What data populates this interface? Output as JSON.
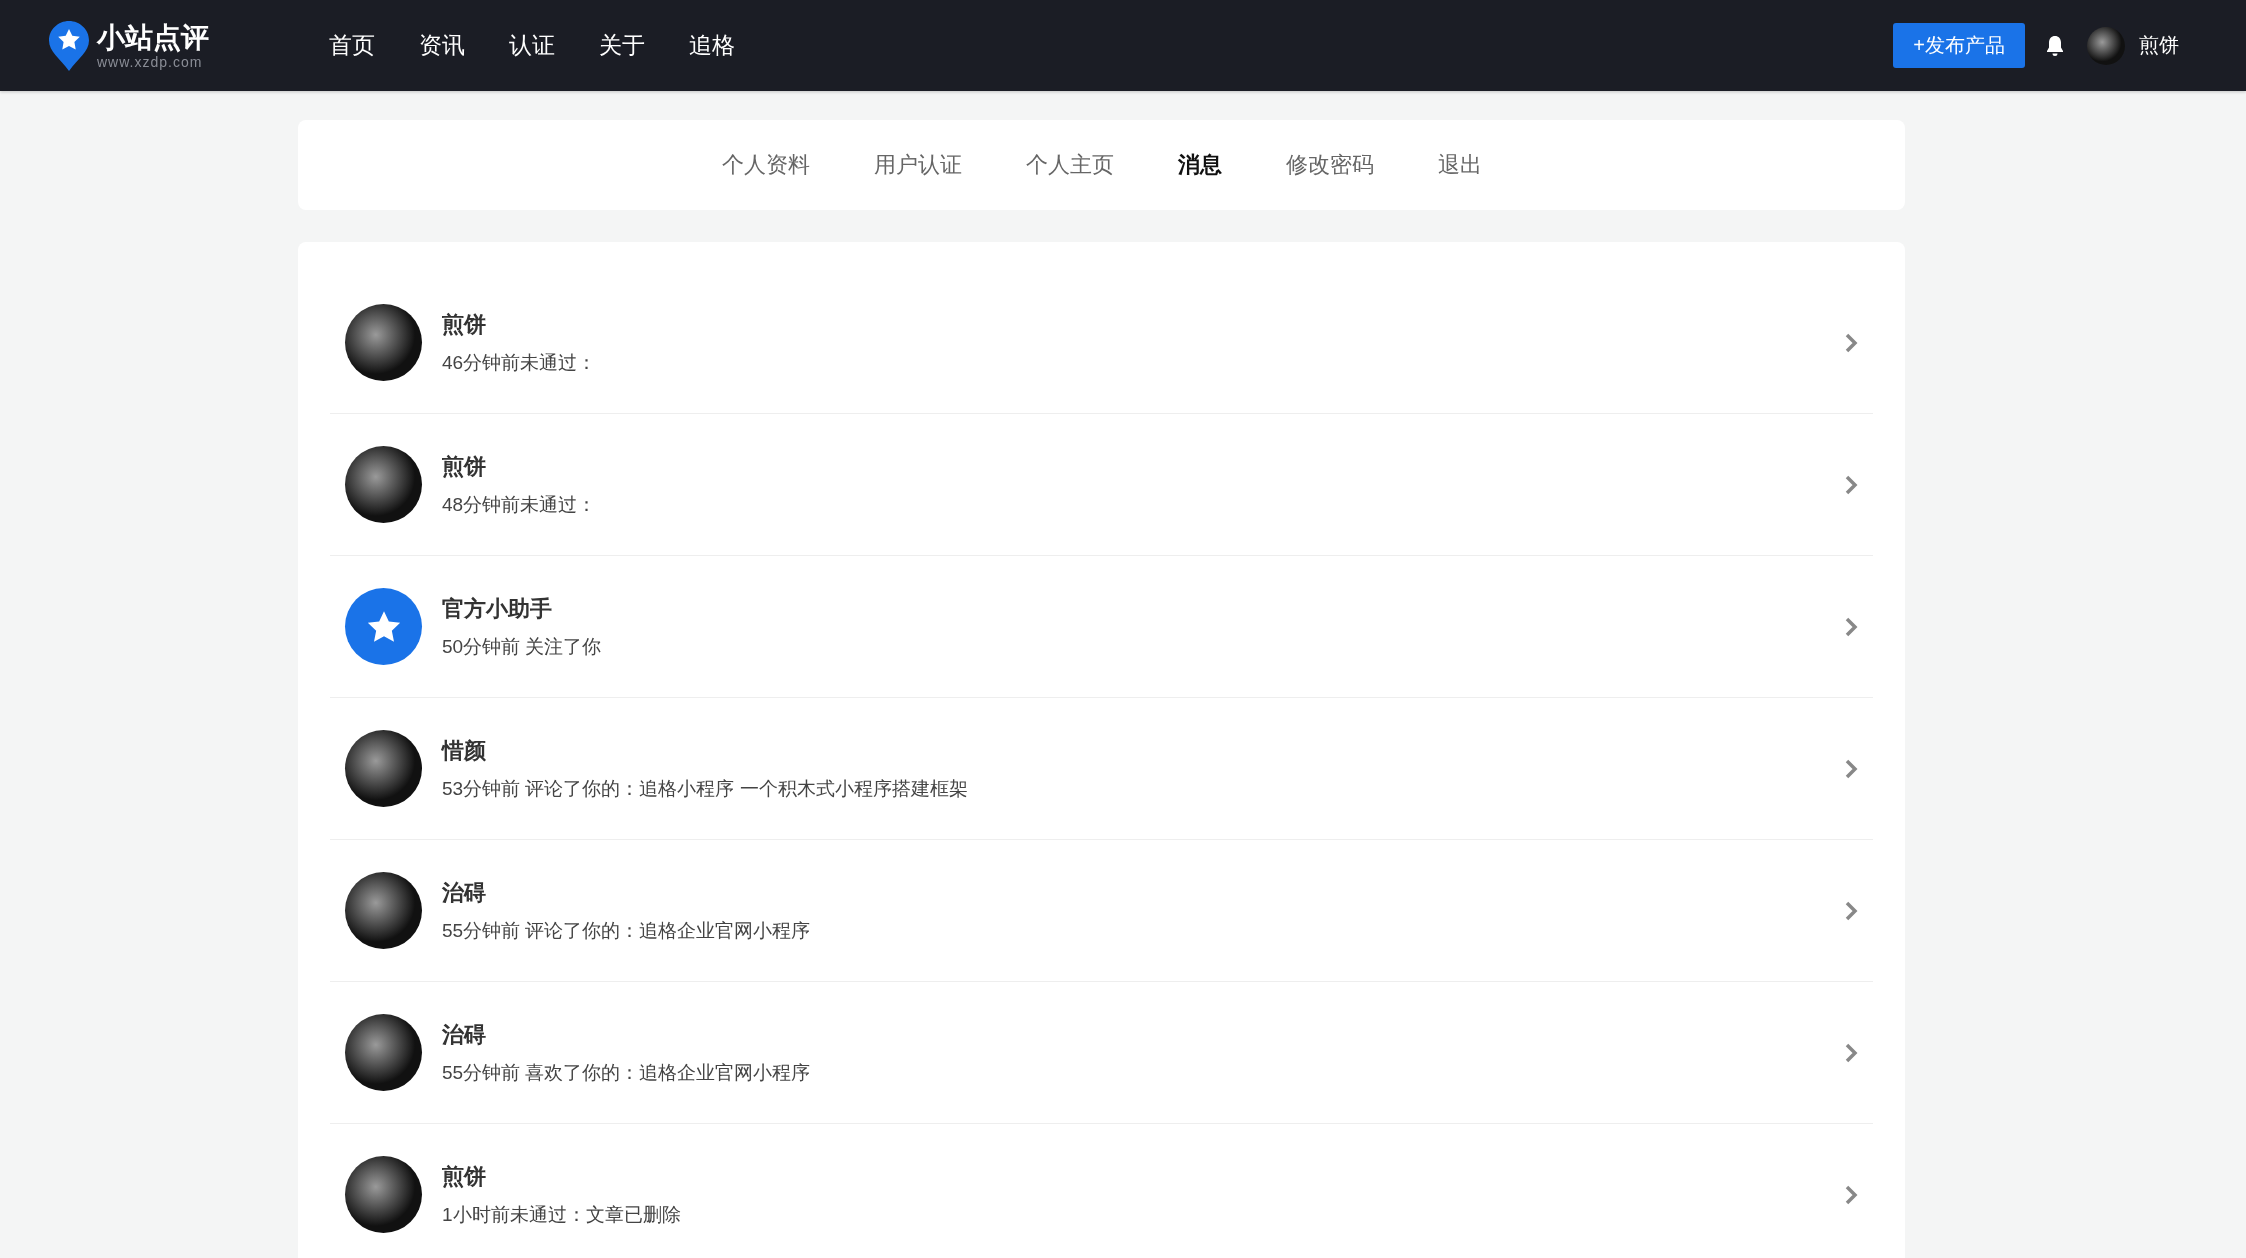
{
  "header": {
    "logo": {
      "title": "小站点评",
      "subtitle": "www.xzdp.com"
    },
    "nav": [
      "首页",
      "资讯",
      "认证",
      "关于",
      "追格"
    ],
    "publish_button": "+发布产品",
    "user": {
      "name": "煎饼"
    }
  },
  "tabs": [
    {
      "label": "个人资料",
      "selected": false
    },
    {
      "label": "用户认证",
      "selected": false
    },
    {
      "label": "个人主页",
      "selected": false
    },
    {
      "label": "消息",
      "selected": true
    },
    {
      "label": "修改密码",
      "selected": false
    },
    {
      "label": "退出",
      "selected": false
    }
  ],
  "messages": [
    {
      "kind": "photo",
      "name": "煎饼",
      "text": "46分钟前未通过："
    },
    {
      "kind": "photo",
      "name": "煎饼",
      "text": "48分钟前未通过："
    },
    {
      "kind": "official",
      "name": "官方小助手",
      "text": "50分钟前 关注了你"
    },
    {
      "kind": "photo",
      "name": "惜颜",
      "text": "53分钟前 评论了你的：追格小程序 一个积木式小程序搭建框架"
    },
    {
      "kind": "photo",
      "name": "治碍",
      "text": "55分钟前 评论了你的：追格企业官网小程序"
    },
    {
      "kind": "photo",
      "name": "治碍",
      "text": "55分钟前 喜欢了你的：追格企业官网小程序"
    },
    {
      "kind": "photo",
      "name": "煎饼",
      "text": "1小时前未通过：文章已删除"
    }
  ]
}
